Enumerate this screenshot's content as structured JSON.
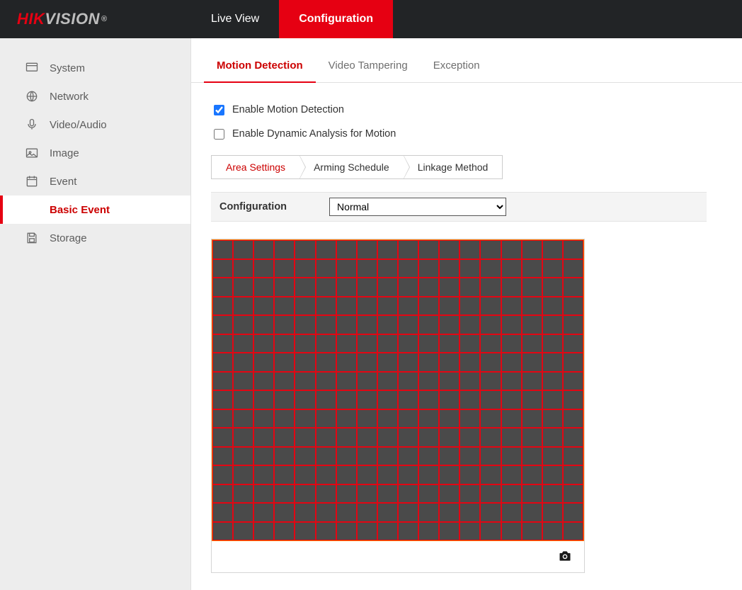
{
  "brand": {
    "prefix": "HIK",
    "suffix": "VISION",
    "reg": "®"
  },
  "topnav": {
    "live_view": "Live View",
    "configuration": "Configuration"
  },
  "sidebar": {
    "system": "System",
    "network": "Network",
    "video_audio": "Video/Audio",
    "image": "Image",
    "event": "Event",
    "basic_event": "Basic Event",
    "storage": "Storage"
  },
  "tabs": {
    "motion_detection": "Motion Detection",
    "video_tampering": "Video Tampering",
    "exception": "Exception"
  },
  "checks": {
    "enable_motion": "Enable Motion Detection",
    "enable_dynamic": "Enable Dynamic Analysis for Motion"
  },
  "bc_tabs": {
    "area_settings": "Area Settings",
    "arming_schedule": "Arming Schedule",
    "linkage_method": "Linkage Method"
  },
  "config": {
    "label": "Configuration",
    "selected": "Normal"
  },
  "grid": {
    "rows": 16,
    "cols": 18
  },
  "icons": {
    "camera": "camera-icon"
  }
}
